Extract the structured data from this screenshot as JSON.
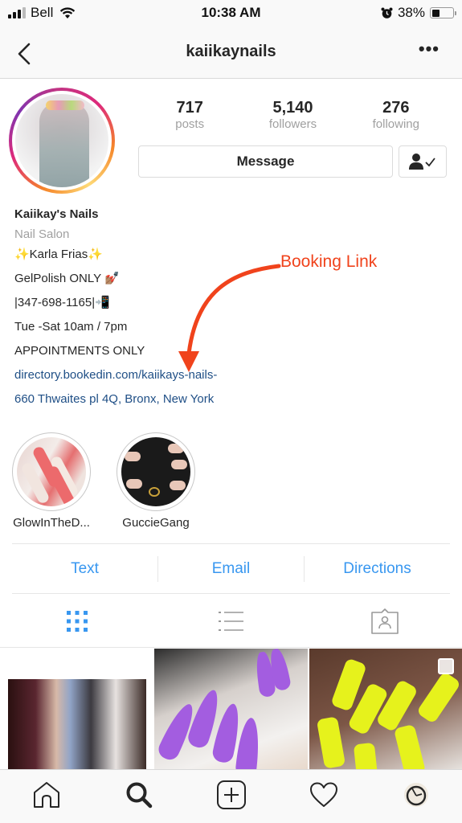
{
  "status_bar": {
    "carrier": "Bell",
    "time": "10:38 AM",
    "battery_percent_label": "38%",
    "battery_level": 0.38,
    "signal_bars_active": 3,
    "signal_bars_total": 4
  },
  "header": {
    "title": "kaiikaynails",
    "back_icon": "chevron-left-icon",
    "more_icon": "more-horizontal-icon",
    "more_label": "•••"
  },
  "profile": {
    "stats": [
      {
        "value": "717",
        "label": "posts"
      },
      {
        "value": "5,140",
        "label": "followers"
      },
      {
        "value": "276",
        "label": "following"
      }
    ],
    "message_label": "Message",
    "following_icon": "person-check-icon",
    "story_ring_colors": [
      "#f58529",
      "#dd2a7b",
      "#8134af"
    ]
  },
  "bio": {
    "name": "Kaiikay's Nails",
    "category": "Nail Salon",
    "lines": [
      "✨Karla Frias✨",
      "GelPolish ONLY 💅🏽",
      "|347-698-1165|📲",
      "Tue -Sat 10am / 7pm",
      "APPOINTMENTS ONLY"
    ],
    "link": "directory.bookedin.com/kaiikays-nails-",
    "address": "660 Thwaites pl 4Q, Bronx, New York"
  },
  "annotation": {
    "label": "Booking Link",
    "color": "#f0431c"
  },
  "highlights": [
    {
      "label": "GlowInTheD..."
    },
    {
      "label": "GuccieGang"
    }
  ],
  "contact_buttons": [
    {
      "label": "Text"
    },
    {
      "label": "Email"
    },
    {
      "label": "Directions"
    }
  ],
  "contact_color": "#3897f0",
  "view_tabs": [
    {
      "name": "grid-view",
      "icon": "grid-icon",
      "active": true
    },
    {
      "name": "list-view",
      "icon": "list-icon",
      "active": false
    },
    {
      "name": "tagged-view",
      "icon": "tagged-person-icon",
      "active": false
    }
  ],
  "posts": [
    {
      "description": "group photo of four women at a club"
    },
    {
      "description": "purple stiletto nails with gold stripes"
    },
    {
      "description": "neon yellow coffin nails with rhinestones",
      "multiple": true
    }
  ],
  "bottom_nav": [
    {
      "name": "home",
      "icon": "home-icon"
    },
    {
      "name": "search",
      "icon": "search-icon",
      "active": true
    },
    {
      "name": "new-post",
      "icon": "add-post-icon"
    },
    {
      "name": "activity",
      "icon": "heart-icon"
    },
    {
      "name": "profile",
      "icon": "profile-avatar-icon"
    }
  ]
}
